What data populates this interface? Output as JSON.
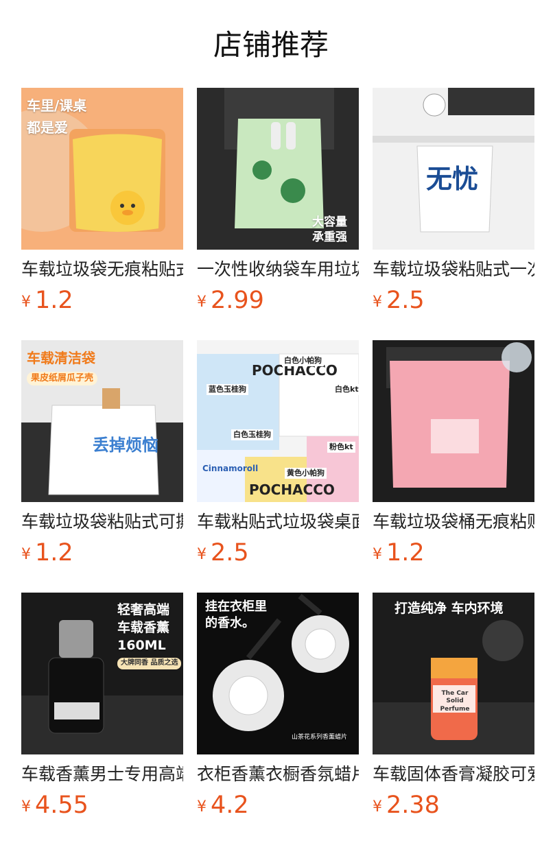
{
  "header": {
    "title": "店铺推荐"
  },
  "currency_symbol": "¥",
  "accent_color": "#e8531d",
  "products": [
    {
      "name": "车载垃圾袋无痕粘贴式",
      "price": "1.2",
      "image_text": [
        "车里/课桌",
        "都是爱"
      ]
    },
    {
      "name": "一次性收纳袋车用垃圾袋",
      "price": "2.99",
      "image_text": [
        "大容量",
        "承重强"
      ]
    },
    {
      "name": "车载垃圾袋粘贴式一次性",
      "price": "2.5",
      "image_text": [
        "无忧"
      ]
    },
    {
      "name": "车载垃圾袋粘贴式可撕拉",
      "price": "1.2",
      "image_text": [
        "车载清洁袋",
        "果皮纸屑瓜子壳",
        "丢掉烦恼"
      ]
    },
    {
      "name": "车载粘贴式垃圾袋桌面",
      "price": "2.5",
      "image_text": [
        "POCHACCO",
        "白色小帕狗",
        "蓝色玉桂狗",
        "白色kt",
        "白色玉桂狗",
        "粉色kt",
        "黄色小帕狗",
        "POCHACCO",
        "Cinnamoroll"
      ]
    },
    {
      "name": "车载垃圾袋桶无痕粘贴",
      "price": "1.2",
      "image_text": []
    },
    {
      "name": "车载香薰男士专用高端",
      "price": "4.55",
      "image_text": [
        "轻奢高端",
        "车载香薰",
        "160ML",
        "大牌同香 品质之选"
      ]
    },
    {
      "name": "衣柜香薰衣橱香氛蜡片",
      "price": "4.2",
      "image_text": [
        "挂在衣柜里",
        "的香水。",
        "山茶花系列香薰蜡片"
      ]
    },
    {
      "name": "车载固体香膏凝胶可爱",
      "price": "2.38",
      "image_text": [
        "打造纯净 车内环境",
        "The Car Solid Perfume"
      ]
    }
  ]
}
